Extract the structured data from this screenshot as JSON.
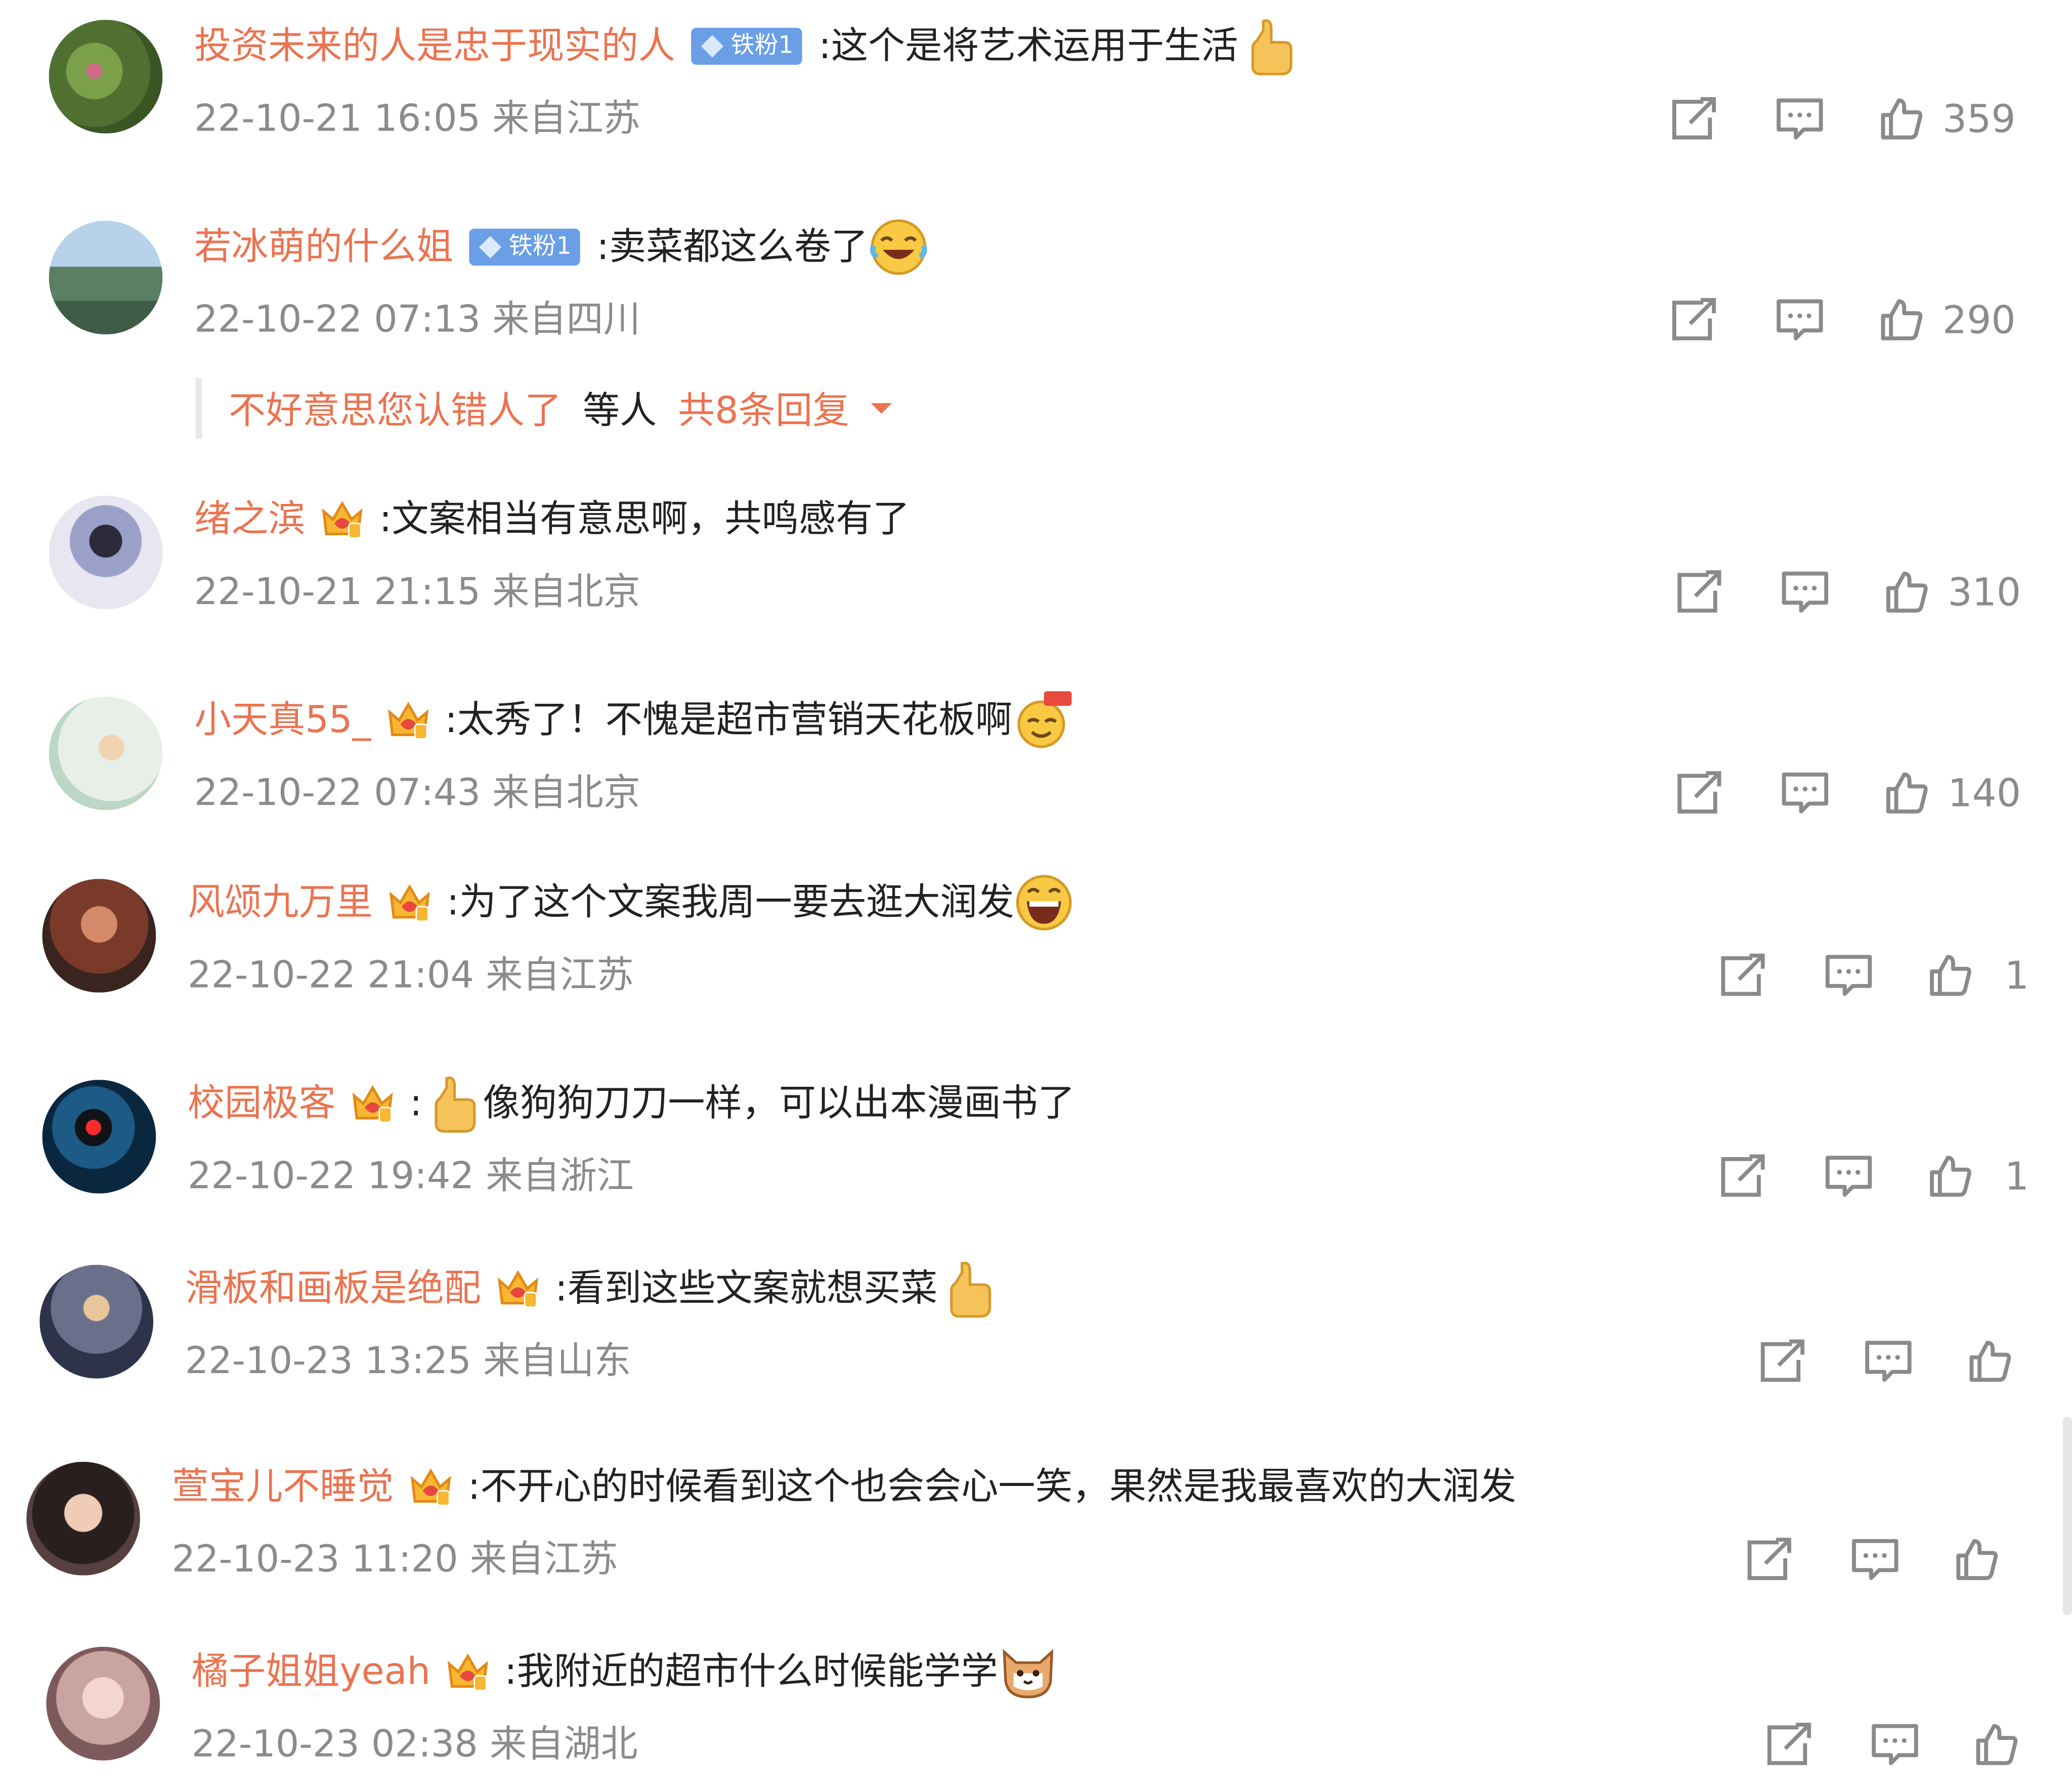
{
  "colors": {
    "username": "#eb7350",
    "meta": "#8b8b8b",
    "text": "#222222",
    "fan_badge": "#6a9fe6",
    "icon": "#8a8a8a"
  },
  "comments": [
    {
      "user": "投资未来的人是忠于现实的人",
      "badge": "fan",
      "badge_text": "铁粉1",
      "text": ":这个是将艺术运用于生活",
      "emoji": "thumbs-up",
      "meta": "22-10-21 16:05 来自江苏",
      "likes": "359",
      "avatar_color": "#5a7f3c"
    },
    {
      "user": "若冰萌的什么姐",
      "badge": "fan",
      "badge_text": "铁粉1",
      "text": ":卖菜都这么卷了",
      "emoji": "laughing-tears",
      "meta": "22-10-22 07:13 来自四川",
      "likes": "290",
      "avatar_color": "#5f87a8"
    },
    {
      "user": "绪之滨",
      "badge": "vip",
      "text": ":文案相当有意思啊，共鸣感有了",
      "emoji": "",
      "meta": "22-10-21 21:15 来自北京",
      "likes": "310",
      "avatar_color": "#c9c4dc"
    },
    {
      "user": "小天真55_",
      "badge": "vip",
      "text": ":太秀了！不愧是超市营销天花板啊",
      "emoji": "666-face",
      "meta": "22-10-22 07:43 来自北京",
      "likes": "140",
      "avatar_color": "#e4ebe6"
    },
    {
      "user": "风颂九万里",
      "badge": "vip",
      "text": ":为了这个文案我周一要去逛大润发",
      "emoji": "big-laugh",
      "meta": "22-10-22 21:04 来自江苏",
      "likes": "1",
      "avatar_color": "#6b3a2c"
    },
    {
      "user": "校园极客",
      "badge": "vip",
      "text_prefix": ":",
      "emoji_inline": "thumbs-up",
      "text": "像狗狗刀刀一样，可以出本漫画书了",
      "meta": "22-10-22 19:42 来自浙江",
      "likes": "1",
      "avatar_color": "#0d2a44"
    },
    {
      "user": "滑板和画板是绝配",
      "badge": "vip",
      "text": ":看到这些文案就想买菜",
      "emoji": "thumbs-up",
      "meta": "22-10-23 13:25 来自山东",
      "likes": "",
      "avatar_color": "#4a4f66"
    },
    {
      "user": "萱宝儿不睡觉",
      "badge": "vip",
      "text": ":不开心的时候看到这个也会会心一笑，果然是我最喜欢的大润发",
      "emoji": "",
      "meta": "22-10-23 11:20 来自江苏",
      "likes": "",
      "avatar_color": "#3b2b2b"
    },
    {
      "user": "橘子姐姐yeah",
      "badge": "vip",
      "text": ":我附近的超市什么时候能学学",
      "emoji": "cat-face",
      "meta": "22-10-23 02:38 来自湖北",
      "likes": "",
      "avatar_color": "#d7b2ae"
    }
  ],
  "replies": {
    "name": "不好意思您认错人了",
    "mid": "等人",
    "more": "共8条回复"
  }
}
